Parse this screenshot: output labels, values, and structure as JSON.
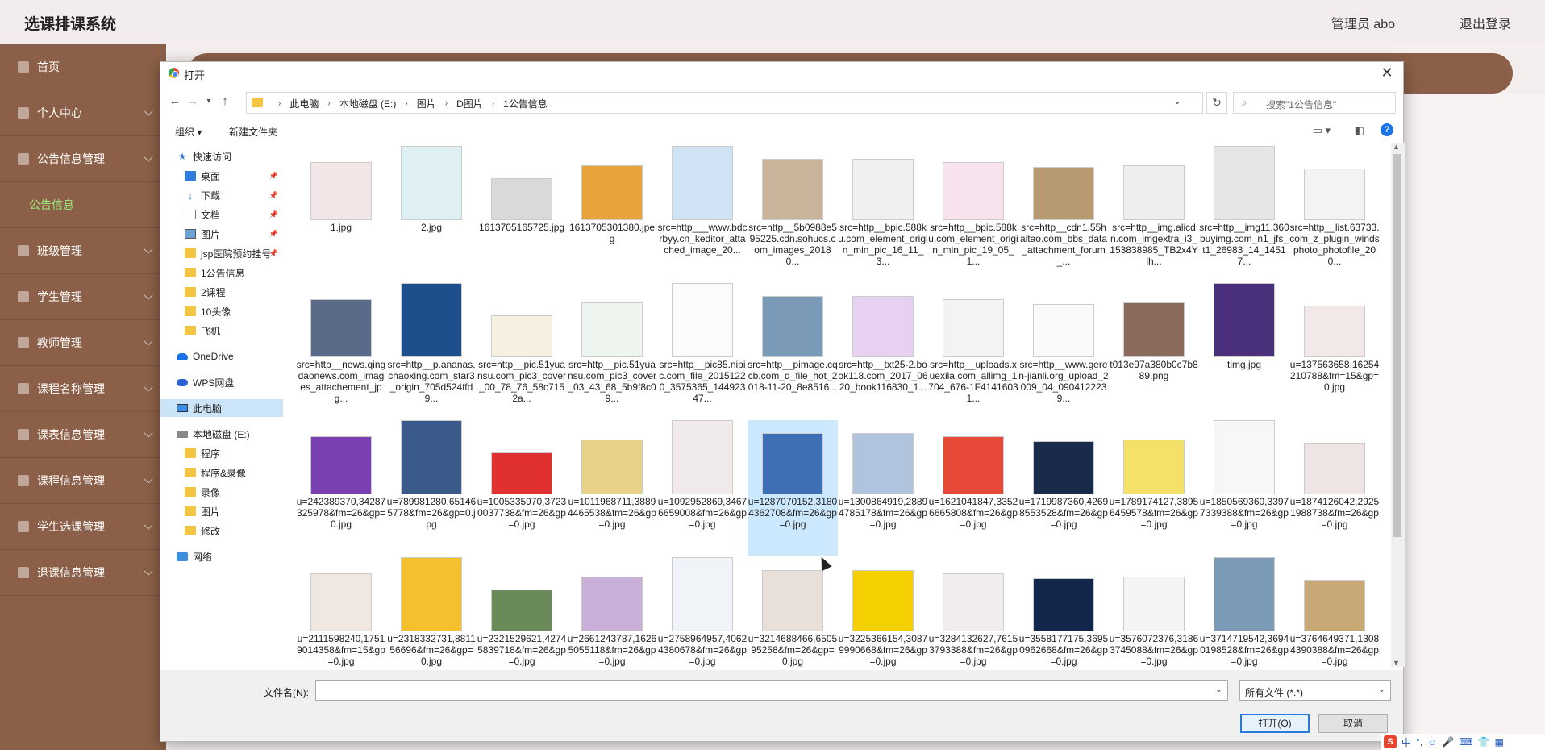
{
  "app": {
    "title": "选课排课系统",
    "admin": "管理员 abo",
    "logout": "退出登录"
  },
  "sidebar": {
    "items": [
      {
        "label": "首页",
        "expandable": false
      },
      {
        "label": "个人中心",
        "expandable": true
      },
      {
        "label": "公告信息管理",
        "expandable": true
      },
      {
        "label": "公告信息",
        "sub": true
      },
      {
        "label": "班级管理",
        "expandable": true
      },
      {
        "label": "学生管理",
        "expandable": true
      },
      {
        "label": "教师管理",
        "expandable": true
      },
      {
        "label": "课程名称管理",
        "expandable": true
      },
      {
        "label": "课表信息管理",
        "expandable": true
      },
      {
        "label": "课程信息管理",
        "expandable": true
      },
      {
        "label": "学生选课管理",
        "expandable": true
      },
      {
        "label": "退课信息管理",
        "expandable": true
      }
    ]
  },
  "dialog": {
    "title": "打开",
    "breadcrumbs": [
      "此电脑",
      "本地磁盘 (E:)",
      "图片",
      "D图片",
      "1公告信息"
    ],
    "search_placeholder": "搜索\"1公告信息\"",
    "toolbar": {
      "organize": "组织 ▾",
      "new_folder": "新建文件夹"
    },
    "nav": [
      {
        "label": "快速访问",
        "icon": "star-icon",
        "indent": 0
      },
      {
        "label": "桌面",
        "icon": "desktop-icon",
        "indent": 1,
        "pinned": true
      },
      {
        "label": "下载",
        "icon": "download-icon",
        "indent": 1,
        "pinned": true
      },
      {
        "label": "文档",
        "icon": "document-icon",
        "indent": 1,
        "pinned": true
      },
      {
        "label": "图片",
        "icon": "pictures-icon",
        "indent": 1,
        "pinned": true
      },
      {
        "label": "jsp医院预约挂号",
        "icon": "folder-icon",
        "indent": 1,
        "pinned": true
      },
      {
        "label": "1公告信息",
        "icon": "folder-icon",
        "indent": 1
      },
      {
        "label": "2课程",
        "icon": "folder-icon",
        "indent": 1
      },
      {
        "label": "10头像",
        "icon": "folder-icon",
        "indent": 1
      },
      {
        "label": "飞机",
        "icon": "folder-icon",
        "indent": 1
      },
      {
        "label": "OneDrive",
        "icon": "onedrive-icon",
        "indent": 0,
        "gap": true
      },
      {
        "label": "WPS网盘",
        "icon": "wps-cloud-icon",
        "indent": 0,
        "gap": true
      },
      {
        "label": "此电脑",
        "icon": "computer-icon",
        "indent": 0,
        "gap": true,
        "selected": true
      },
      {
        "label": "本地磁盘 (E:)",
        "icon": "drive-icon",
        "indent": 0,
        "gap": true
      },
      {
        "label": "程序",
        "icon": "folder-icon",
        "indent": 1
      },
      {
        "label": "程序&录像",
        "icon": "folder-icon",
        "indent": 1
      },
      {
        "label": "录像",
        "icon": "folder-icon",
        "indent": 1
      },
      {
        "label": "图片",
        "icon": "folder-icon",
        "indent": 1
      },
      {
        "label": "修改",
        "icon": "folder-icon",
        "indent": 1
      },
      {
        "label": "网络",
        "icon": "network-icon",
        "indent": 0,
        "gap": true
      }
    ],
    "files": [
      {
        "name": "1.jpg",
        "color": "#f2e6e6"
      },
      {
        "name": "2.jpg",
        "color": "#dff0f2"
      },
      {
        "name": "1613705165725.jpg",
        "color": "#d9d9d9"
      },
      {
        "name": "1613705301380.jpeg",
        "color": "#e8a33a"
      },
      {
        "name": "src=http___www.bdcrbyy.cn_keditor_attached_image_20...",
        "color": "#cfe3f5"
      },
      {
        "name": "src=http__5b0988e595225.cdn.sohucs.com_images_20180...",
        "color": "#c9b39a"
      },
      {
        "name": "src=http__bpic.588ku.com_element_origin_min_pic_16_11_3...",
        "color": "#f0f0f0"
      },
      {
        "name": "src=http__bpic.588ku.com_element_origin_min_pic_19_05_1...",
        "color": "#f7e3ee"
      },
      {
        "name": "src=http__cdn1.55haitao.com_bbs_data_attachment_forum_...",
        "color": "#b89a70"
      },
      {
        "name": "src=http__img.alicdn.com_imgextra_i3_153838985_TB2x4Ylh...",
        "color": "#eeeeee"
      },
      {
        "name": "src=http__img11.360buyimg.com_n1_jfs_t1_26983_14_14517...",
        "color": "#e6e6e6"
      },
      {
        "name": "src=http__list.63733.com_z_plugin_windsphoto_photofile_200...",
        "color": "#f3f3f3"
      },
      {
        "name": "src=http__news.qingdaonews.com_images_attachement_jpg...",
        "color": "#5a6b8a"
      },
      {
        "name": "src=http__p.ananas.chaoxing.com_star3_origin_705d524ffd9...",
        "color": "#1e4e8c"
      },
      {
        "name": "src=http__pic.51yuansu.com_pic3_cover_00_78_76_58c7152a...",
        "color": "#f5f0e0"
      },
      {
        "name": "src=http__pic.51yuansu.com_pic3_cover_03_43_68_5b9f8c09...",
        "color": "#eef5ee"
      },
      {
        "name": "src=http__pic85.nipic.com_file_20151220_3575365_14492347...",
        "color": "#fbfbfb"
      },
      {
        "name": "src=http__pimage.cqcb.com_d_file_hot_2018-11-20_8e8516...",
        "color": "#7a9ab8"
      },
      {
        "name": "src=http__txt25-2.book118.com_2017_0620_book116830_1...",
        "color": "#e6d2f0"
      },
      {
        "name": "src=http__uploads.xuexila.com_allimg_1704_676-1F41416031...",
        "color": "#f3f3f3"
      },
      {
        "name": "src=http__www.geren-jianli.org_upload_2009_04_0904122239...",
        "color": "#fafafa"
      },
      {
        "name": "t013e97a380b0c7b889.png",
        "color": "#8a6a5a"
      },
      {
        "name": "timg.jpg",
        "color": "#4a2f7a"
      },
      {
        "name": "u=137563658,16254210788&fm=15&gp=0.jpg",
        "color": "#f2e8e8"
      },
      {
        "name": "u=242389370,34287325978&fm=26&gp=0.jpg",
        "color": "#7a3fb0"
      },
      {
        "name": "u=789981280,651465778&fm=26&gp=0.jpg",
        "color": "#3a5a8a"
      },
      {
        "name": "u=1005335970,37230037738&fm=26&gp=0.jpg",
        "color": "#e03030"
      },
      {
        "name": "u=1011968711,38894465538&fm=26&gp=0.jpg",
        "color": "#e8d28a"
      },
      {
        "name": "u=1092952869,34676659008&fm=26&gp=0.jpg",
        "color": "#f0eaea"
      },
      {
        "name": "u=1287070152,31804362708&fm=26&gp=0.jpg",
        "color": "#3e6fb5"
      },
      {
        "name": "u=1300864919,28894785178&fm=26&gp=0.jpg",
        "color": "#b0c4de"
      },
      {
        "name": "u=1621041847,33526665808&fm=26&gp=0.jpg",
        "color": "#e84a3a"
      },
      {
        "name": "u=1719987360,42698553528&fm=26&gp=0.jpg",
        "color": "#1a2a4a"
      },
      {
        "name": "u=1789174127,38956459578&fm=26&gp=0.jpg",
        "color": "#f5e06a"
      },
      {
        "name": "u=1850569360,33977339388&fm=26&gp=0.jpg",
        "color": "#f7f7f7"
      },
      {
        "name": "u=1874126042,29251988738&fm=26&gp=0.jpg",
        "color": "#efe4e4"
      },
      {
        "name": "u=2111598240,17519014358&fm=15&gp=0.jpg",
        "color": "#f0e8e0"
      },
      {
        "name": "u=2318332731,881156696&fm=26&gp=0.jpg",
        "color": "#f5c030"
      },
      {
        "name": "u=2321529621,42745839718&fm=26&gp=0.jpg",
        "color": "#6a8a5a"
      },
      {
        "name": "u=2661243787,16265055118&fm=26&gp=0.jpg",
        "color": "#c8b0d8"
      },
      {
        "name": "u=2758964957,40624380678&fm=26&gp=0.jpg",
        "color": "#f0f4f8"
      },
      {
        "name": "u=3214688466,650595258&fm=26&gp=0.jpg",
        "color": "#e8e0d8"
      },
      {
        "name": "u=3225366154,30879990668&fm=26&gp=0.jpg",
        "color": "#f5d000"
      },
      {
        "name": "u=3284132627,76153793388&fm=26&gp=0.jpg",
        "color": "#f0ecec"
      },
      {
        "name": "u=3558177175,36950962668&fm=26&gp=0.jpg",
        "color": "#12254a"
      },
      {
        "name": "u=3576072376,31863745088&fm=26&gp=0.jpg",
        "color": "#f4f4f4"
      },
      {
        "name": "u=3714719542,36940198528&fm=26&gp=0.jpg",
        "color": "#7a9ab5"
      },
      {
        "name": "u=3764649371,13084390388&fm=26&gp=0.jpg",
        "color": "#c9a878"
      }
    ],
    "selected_file_index": 29,
    "filename_label": "文件名(N):",
    "filename_value": "",
    "file_type": "所有文件 (*.*)",
    "open_button": "打开(O)",
    "cancel_button": "取消"
  },
  "ime": {
    "items": [
      "S",
      "中",
      "°,",
      "☺",
      "🎤",
      "⌨",
      "👕",
      "▦"
    ]
  }
}
